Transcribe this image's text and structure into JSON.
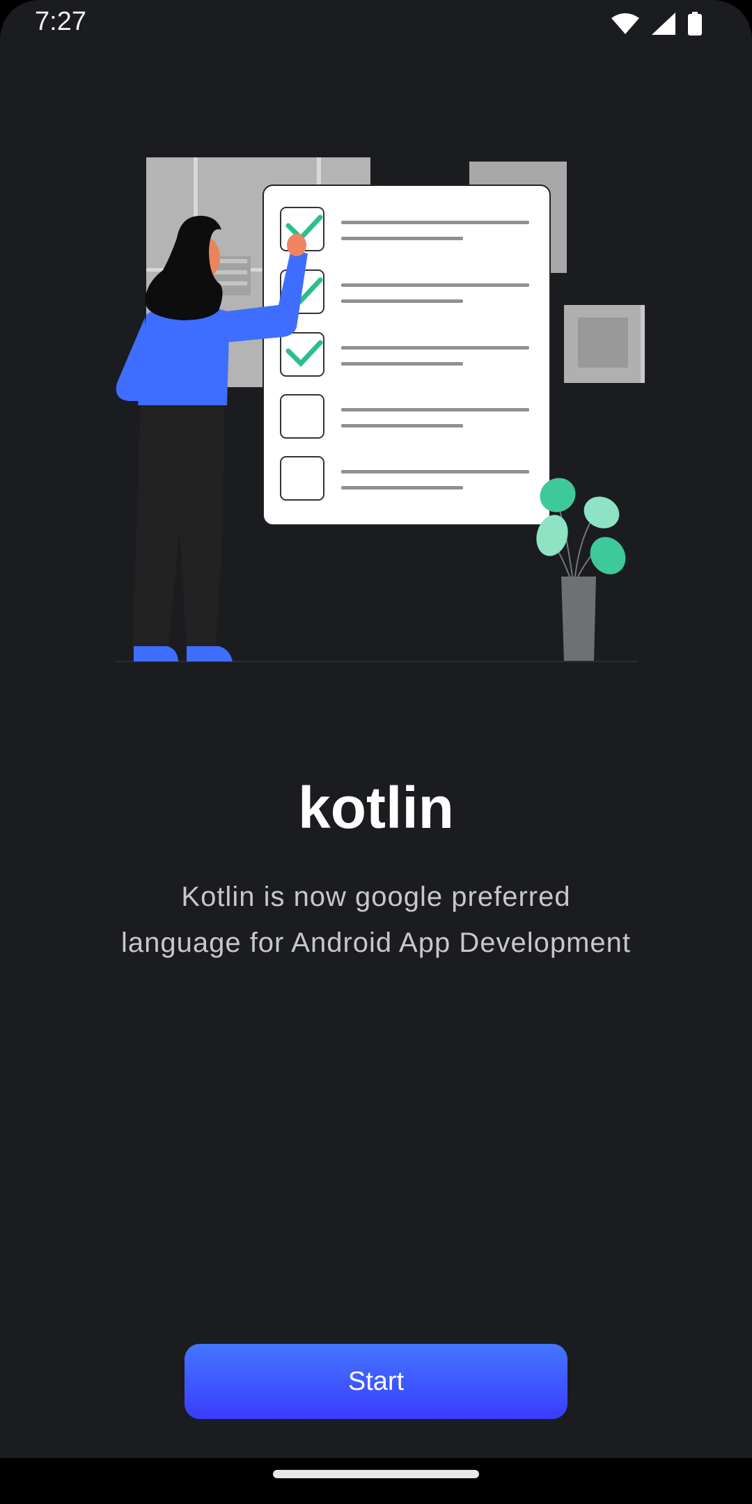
{
  "status_bar": {
    "time": "7:27"
  },
  "onboarding": {
    "title": "kotlin",
    "subtitle_line1": "Kotlin is now google preferred",
    "subtitle_line2": "language for Android App Development",
    "start_label": "Start"
  },
  "illustration": {
    "checklist_items": [
      {
        "checked": true
      },
      {
        "checked": true
      },
      {
        "checked": true
      },
      {
        "checked": false
      },
      {
        "checked": false
      }
    ]
  },
  "colors": {
    "background": "#1a1c1f",
    "accent_blue": "#3f6dff",
    "check_green": "#2bbf8a"
  }
}
